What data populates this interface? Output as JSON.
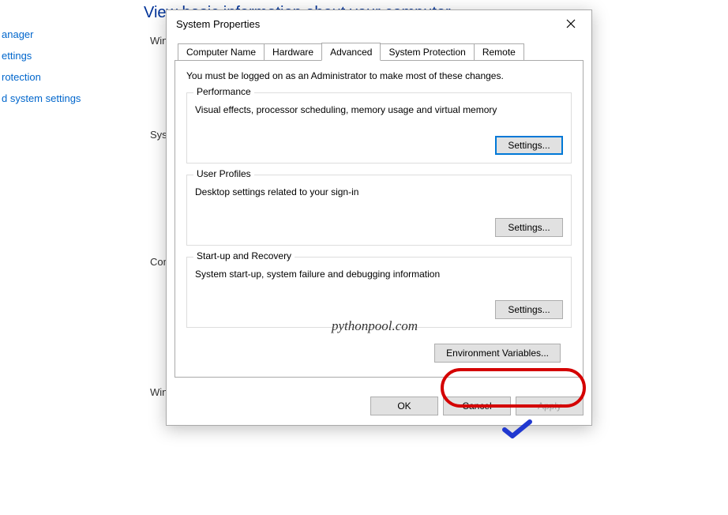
{
  "background": {
    "heading": "View basic information about your computer",
    "links": [
      "anager",
      "ettings",
      "rotection",
      "d system settings"
    ],
    "side_labels": [
      "Win",
      "Syst",
      "Com",
      "Win"
    ]
  },
  "dialog": {
    "title": "System Properties",
    "tabs": [
      "Computer Name",
      "Hardware",
      "Advanced",
      "System Protection",
      "Remote"
    ],
    "active_tab": 2,
    "admin_note": "You must be logged on as an Administrator to make most of these changes.",
    "groups": {
      "performance": {
        "legend": "Performance",
        "desc": "Visual effects, processor scheduling, memory usage and virtual memory",
        "button": "Settings..."
      },
      "user_profiles": {
        "legend": "User Profiles",
        "desc": "Desktop settings related to your sign-in",
        "button": "Settings..."
      },
      "startup": {
        "legend": "Start-up and Recovery",
        "desc": "System start-up, system failure and debugging information",
        "button": "Settings..."
      }
    },
    "env_button": "Environment Variables...",
    "buttons": {
      "ok": "OK",
      "cancel": "Cancel",
      "apply": "Apply"
    }
  },
  "watermark": "pythonpool.com"
}
